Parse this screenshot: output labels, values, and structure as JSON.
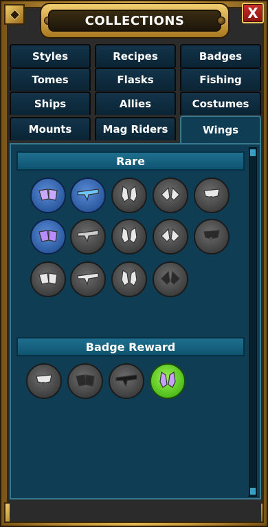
{
  "window": {
    "title": "COLLECTIONS",
    "close_label": "X"
  },
  "tabs": [
    {
      "label": "Styles",
      "active": false
    },
    {
      "label": "Recipes",
      "active": false
    },
    {
      "label": "Badges",
      "active": false
    },
    {
      "label": "Tomes",
      "active": false
    },
    {
      "label": "Flasks",
      "active": false
    },
    {
      "label": "Fishing",
      "active": false
    },
    {
      "label": "Ships",
      "active": false
    },
    {
      "label": "Allies",
      "active": false
    },
    {
      "label": "Costumes",
      "active": false
    },
    {
      "label": "Mounts",
      "active": false
    },
    {
      "label": "Mag Riders",
      "active": false
    },
    {
      "label": "Wings",
      "active": true
    }
  ],
  "sections": [
    {
      "title": "Rare",
      "items": [
        {
          "icon": "crystal-wings-icon",
          "state": "owned",
          "color": "#c9a8ff"
        },
        {
          "icon": "jet-wings-icon",
          "state": "owned",
          "color": "#6fc6ff"
        },
        {
          "icon": "mech-wings-icon",
          "state": "locked",
          "color": "#e8e8e8"
        },
        {
          "icon": "demon-wings-icon",
          "state": "locked",
          "color": "#e8e8e8"
        },
        {
          "icon": "feather-wings-icon",
          "state": "locked",
          "color": "#e8e8e8"
        },
        {
          "icon": "fairy-wings-icon",
          "state": "owned",
          "color": "#b98cff"
        },
        {
          "icon": "bat-wings-icon",
          "state": "locked",
          "color": "#cfcfcf"
        },
        {
          "icon": "cannon-wings-icon",
          "state": "locked",
          "color": "#e8e8e8"
        },
        {
          "icon": "banner-wings-icon",
          "state": "locked",
          "color": "#e8e8e8"
        },
        {
          "icon": "drone-wings-icon",
          "state": "locked",
          "color": "#2a2a2a"
        },
        {
          "icon": "cloud-wings-icon",
          "state": "locked",
          "color": "#e8e8e8"
        },
        {
          "icon": "spiky-wings-icon",
          "state": "locked",
          "color": "#e8e8e8"
        },
        {
          "icon": "angel-wings-icon",
          "state": "locked",
          "color": "#e8e8e8"
        },
        {
          "icon": "gear-wings-icon",
          "state": "locked",
          "color": "#2a2a2a"
        }
      ]
    },
    {
      "title": "Badge Reward",
      "items": [
        {
          "icon": "glider-wings-icon",
          "state": "locked",
          "color": "#e8e8e8"
        },
        {
          "icon": "rotor-wings-icon",
          "state": "locked",
          "color": "#2a2a2a"
        },
        {
          "icon": "pickaxe-wings-icon",
          "state": "locked",
          "color": "#1a1a1a"
        },
        {
          "icon": "gem-wings-icon",
          "state": "new",
          "color": "#c8a0ff"
        }
      ]
    }
  ]
}
